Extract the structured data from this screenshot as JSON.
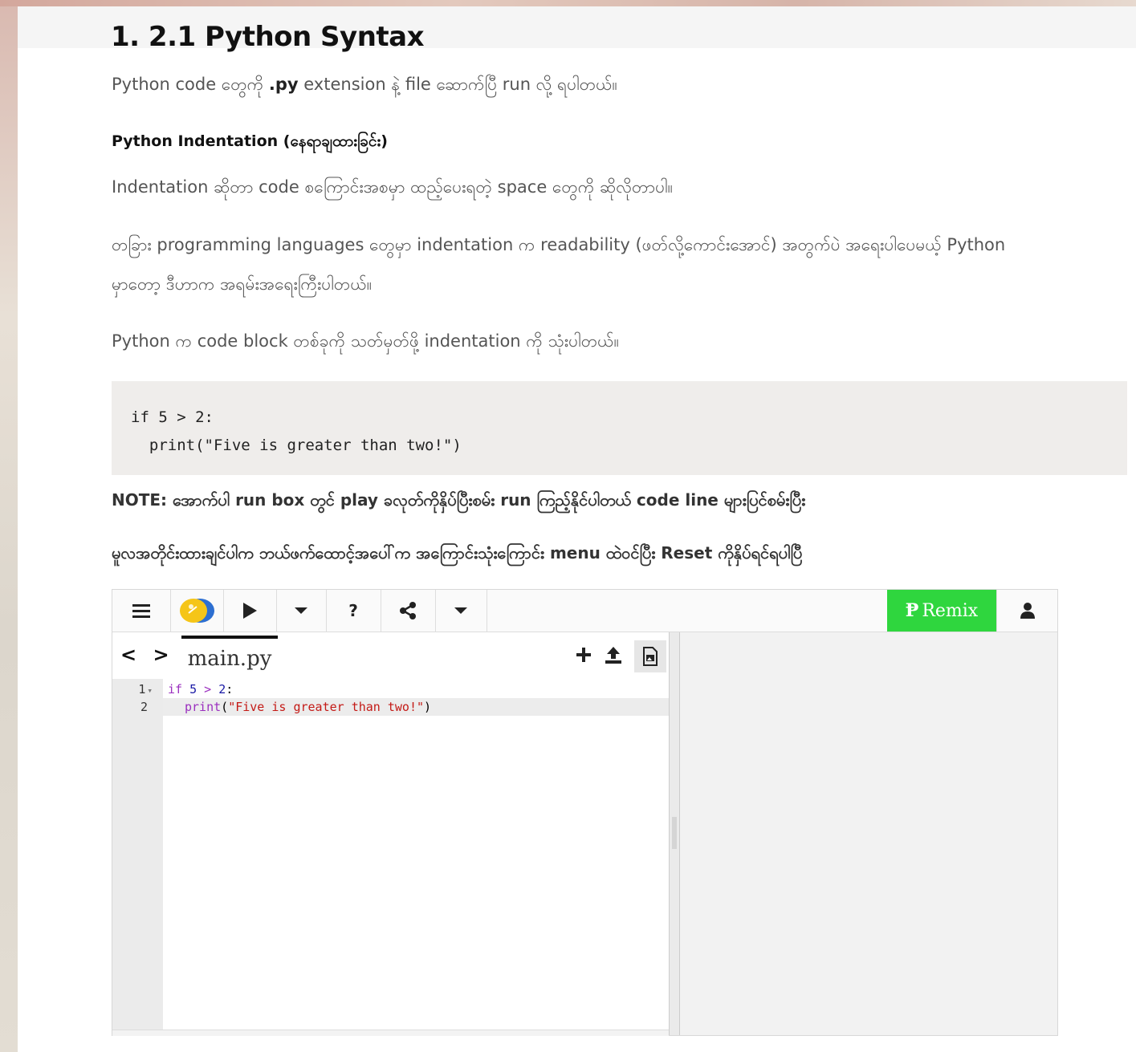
{
  "page_title": "1. 2.1 Python Syntax",
  "intro": {
    "before": "Python code တွေကို ",
    "bold": ".py",
    "after": " extension နဲ့ file ဆောက်ပြီ run လို့ ရပါတယ်။"
  },
  "indentation_heading": "Python Indentation (နေရာချထားခြင်း)",
  "para_indentation": "Indentation ဆိုတာ code စကြောင်းအစမှာ ထည့်ပေးရတဲ့ space တွေကို ဆိုလိုတာပါ။",
  "para_other_line1": "တခြား programming languages တွေမှာ indentation က readability (ဖတ်လို့ကောင်းအောင်) အတွက်ပဲ အရေးပါပေမယ့် Python",
  "para_other_line2": "မှာတော့ ဒီဟာက အရမ်းအရေးကြီးပါတယ်။",
  "para_block": "Python က code block တစ်ခုကို သတ်မှတ်ဖို့ indentation ကို သုံးပါတယ်။",
  "example_code": {
    "line1": "if 5 > 2:",
    "line2": "  print(\"Five is greater than two!\")"
  },
  "note_line1": "NOTE: အောက်ပါ run box တွင် play ခလုတ်ကိုနှိပ်ပြီးစမ်း run ကြည့်နိုင်ပါတယ် code line များပြင်စမ်းပြီး",
  "note_line2": "မူလအတိုင်းထားချင်ပါက ဘယ်ဖက်ထောင့်အပေါ်က အကြောင်းသုံးကြောင်း menu ထဲဝင်ပြီး Reset ကိုနှိပ်ရင်ရပါပြီ",
  "trinket": {
    "toolbar": {
      "menu_icon": "hamburger-menu-icon",
      "logo_icon": "python-logo-icon",
      "run_icon": "play-icon",
      "help_label": "?",
      "share_icon": "share-icon",
      "remix_label": "Remix",
      "user_icon": "user-icon",
      "remix_color": "#2fd63e"
    },
    "file_tab": "main.py",
    "nav_arrows": "< >",
    "file_actions": [
      "plus-icon",
      "upload-icon",
      "image-file-icon"
    ],
    "editor_lines": [
      {
        "number": "1",
        "fold": "▾"
      },
      {
        "number": "2",
        "fold": ""
      }
    ],
    "editor_code": {
      "l1_kw": "if",
      "l1_num1": "5",
      "l1_op": ">",
      "l1_num2": "2",
      "l1_colon": ":",
      "l2_fn": "print",
      "l2_str": "\"Five is greater than two!\"",
      "l2_open": "(",
      "l2_close": ")"
    }
  }
}
